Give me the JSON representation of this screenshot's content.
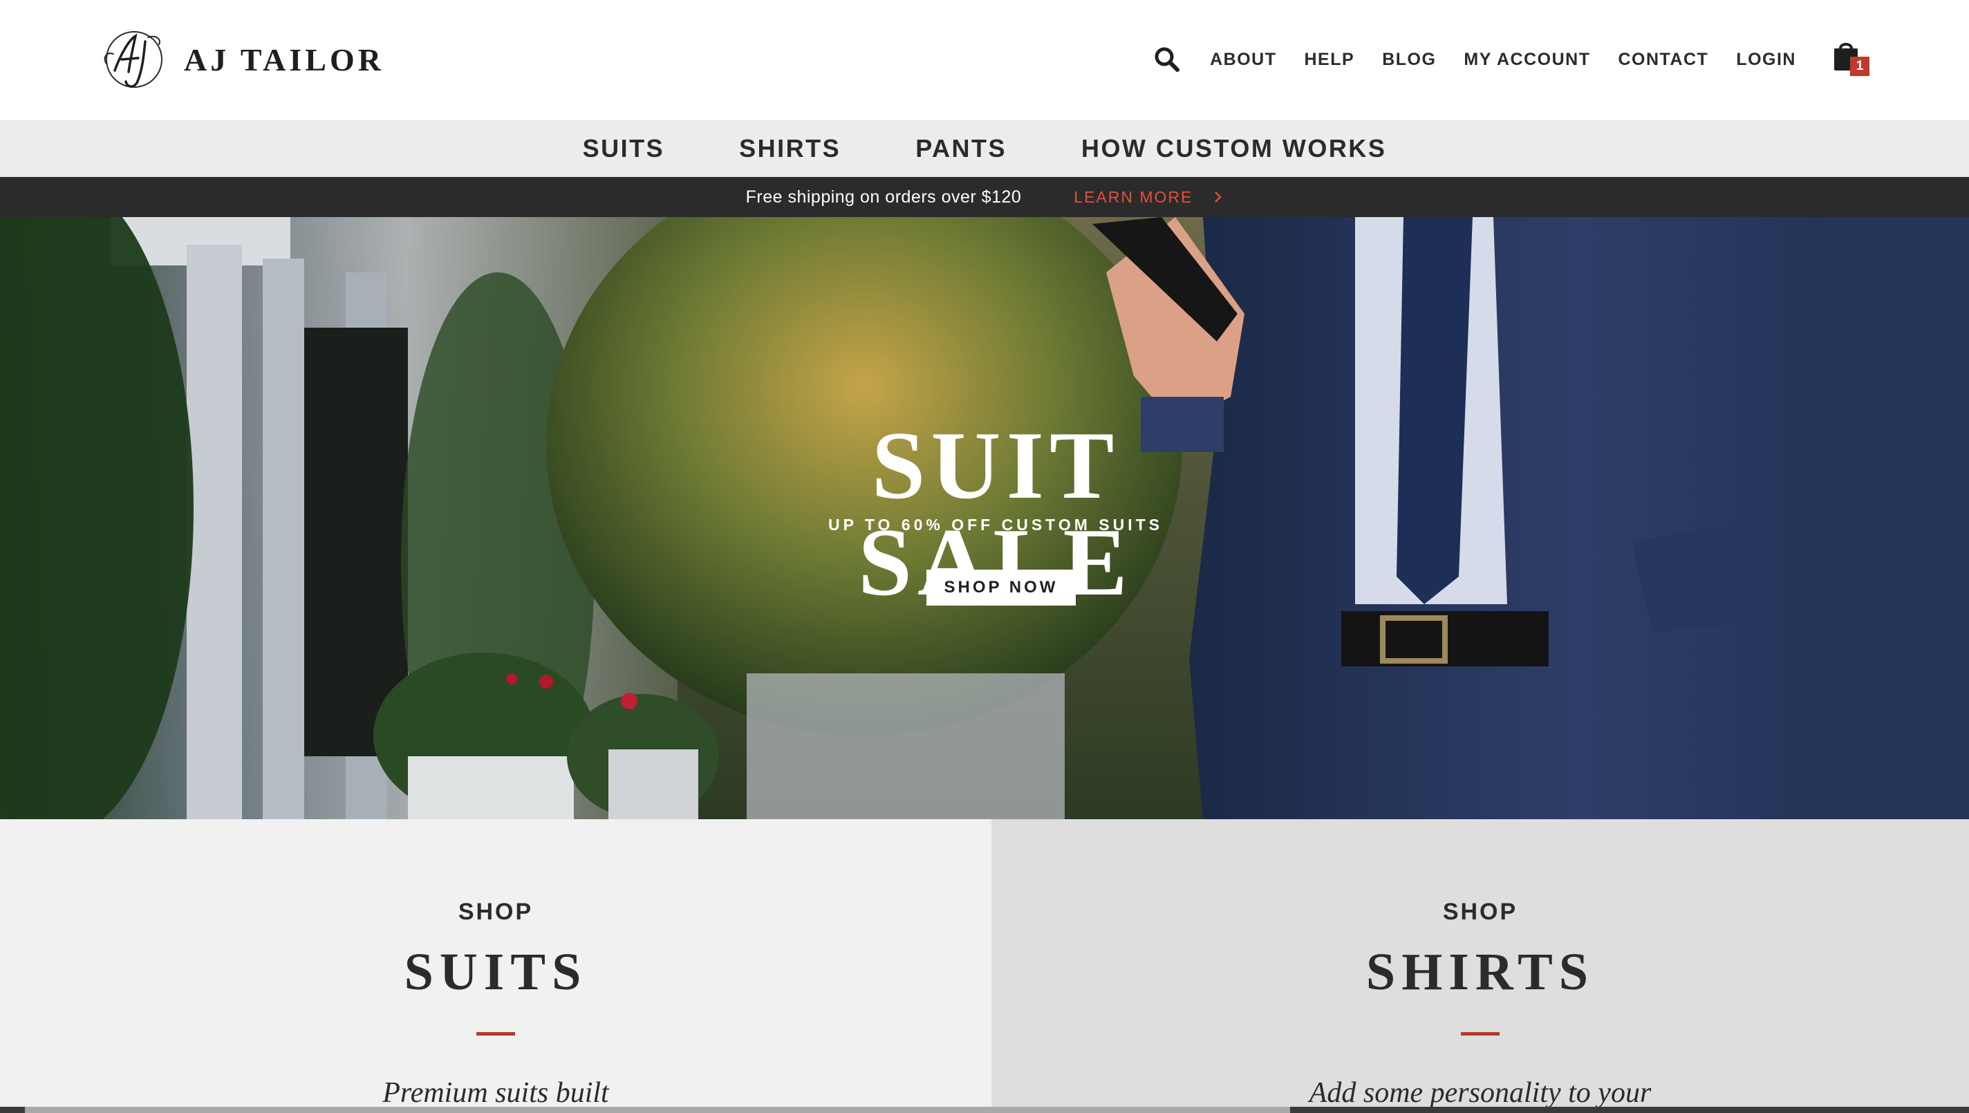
{
  "brand": {
    "name": "AJ TAILOR",
    "monogram": "AJ"
  },
  "topnav": {
    "search_icon": "search-icon",
    "links": [
      "ABOUT",
      "HELP",
      "BLOG",
      "MY ACCOUNT",
      "CONTACT",
      "LOGIN"
    ],
    "cart_icon": "shopping-bag-icon",
    "cart_count": "1"
  },
  "catnav": {
    "items": [
      "SUITS",
      "SHIRTS",
      "PANTS",
      "HOW CUSTOM WORKS"
    ]
  },
  "promo": {
    "text": "Free shipping on orders over $120",
    "link": "LEARN MORE",
    "link_icon": "chevron-right-icon"
  },
  "hero": {
    "title": "SUIT SALE",
    "subtitle": "UP TO 60% OFF CUSTOM SUITS",
    "button": "SHOP NOW"
  },
  "panels": [
    {
      "kicker": "SHOP",
      "title": "SUITS",
      "desc": "Premium suits built"
    },
    {
      "kicker": "SHOP",
      "title": "SHIRTS",
      "desc": "Add some personality to your"
    }
  ],
  "colors": {
    "accent": "#c0392b",
    "promo_link": "#e0523d",
    "promo_bar": "#2b2b2b",
    "catnav_bg": "#ececec",
    "panel_left": "#f1f1f1",
    "panel_right": "#dedede"
  }
}
